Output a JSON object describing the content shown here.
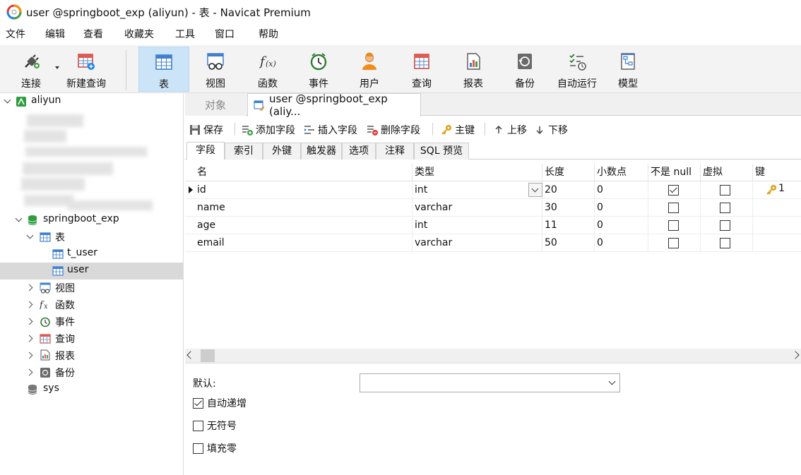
{
  "window": {
    "title": "user @springboot_exp (aliyun) - 表 - Navicat Premium"
  },
  "menu": [
    "文件",
    "编辑",
    "查看",
    "收藏夹",
    "工具",
    "窗口",
    "帮助"
  ],
  "toolbar": {
    "connect": "连接",
    "new_query": "新建查询",
    "table": "表",
    "view": "视图",
    "function": "函数",
    "event": "事件",
    "user": "用户",
    "query": "查询",
    "report": "报表",
    "backup": "备份",
    "automation": "自动运行",
    "model": "模型"
  },
  "sidebar": {
    "connection": "aliyun",
    "database": "springboot_exp",
    "tables_folder": "表",
    "tables": [
      "t_user",
      "user"
    ],
    "views": "视图",
    "functions": "函数",
    "events": "事件",
    "queries": "查询",
    "reports": "报表",
    "backups": "备份",
    "sys": "sys"
  },
  "tabs": {
    "objects": "对象",
    "active": "user @springboot_exp (aliy..."
  },
  "actions": {
    "save": "保存",
    "add_field": "添加字段",
    "insert_field": "插入字段",
    "delete_field": "删除字段",
    "primary_key": "主键",
    "move_up": "上移",
    "move_down": "下移"
  },
  "subtabs": [
    "字段",
    "索引",
    "外键",
    "触发器",
    "选项",
    "注释",
    "SQL 预览"
  ],
  "grid": {
    "headers": {
      "name": "名",
      "type": "类型",
      "length": "长度",
      "decimals": "小数点",
      "not_null": "不是 null",
      "virtual": "虚拟",
      "key": "键"
    },
    "rows": [
      {
        "name": "id",
        "type": "int",
        "length": "20",
        "decimals": "0",
        "not_null": true,
        "virtual": false,
        "key": "1"
      },
      {
        "name": "name",
        "type": "varchar",
        "length": "30",
        "decimals": "0",
        "not_null": false,
        "virtual": false,
        "key": ""
      },
      {
        "name": "age",
        "type": "int",
        "length": "11",
        "decimals": "0",
        "not_null": false,
        "virtual": false,
        "key": ""
      },
      {
        "name": "email",
        "type": "varchar",
        "length": "50",
        "decimals": "0",
        "not_null": false,
        "virtual": false,
        "key": ""
      }
    ]
  },
  "properties": {
    "default_label": "默认:",
    "default_value": "",
    "auto_increment": {
      "label": "自动递增",
      "checked": true
    },
    "unsigned": {
      "label": "无符号",
      "checked": false
    },
    "zerofill": {
      "label": "填充零",
      "checked": false
    }
  }
}
